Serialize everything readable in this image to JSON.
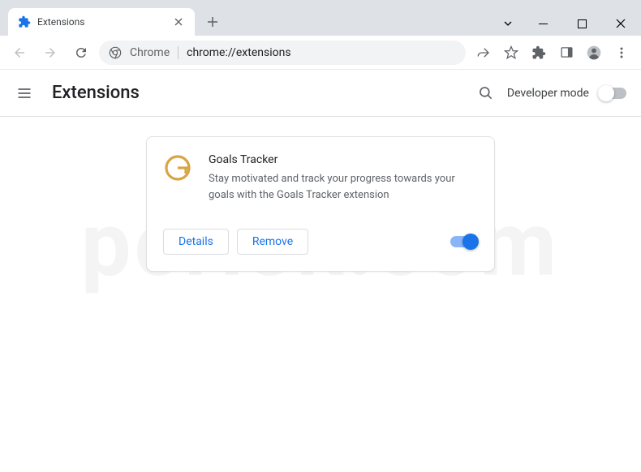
{
  "window": {
    "tab_title": "Extensions"
  },
  "omnibox": {
    "origin": "Chrome",
    "url": "chrome://extensions"
  },
  "page": {
    "title": "Extensions",
    "developer_mode_label": "Developer mode",
    "developer_mode_on": false
  },
  "extension_card": {
    "name": "Goals Tracker",
    "description": "Stay motivated and track your progress towards your goals with the Goals Tracker extension",
    "details_label": "Details",
    "remove_label": "Remove",
    "enabled": true
  },
  "watermark": "pcrisk.com"
}
